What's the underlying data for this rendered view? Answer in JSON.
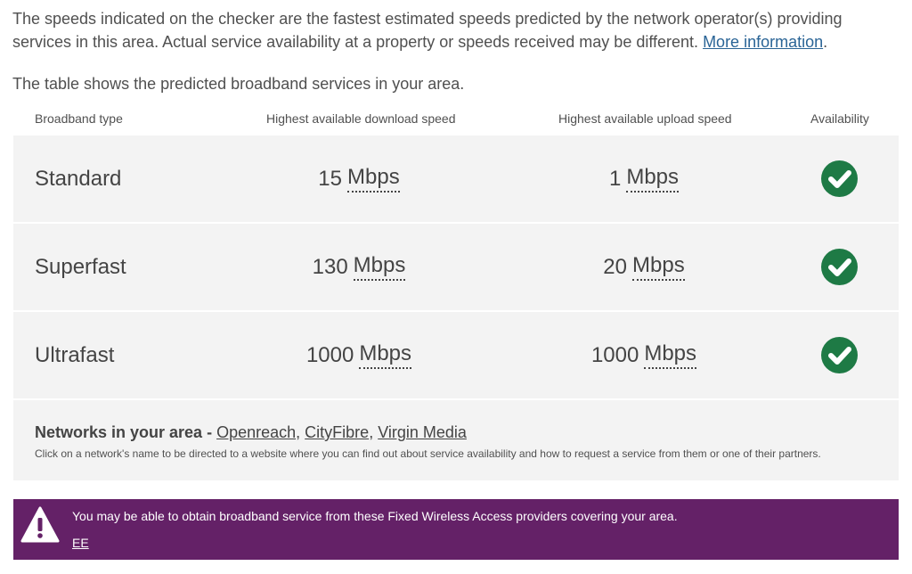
{
  "intro": {
    "text": "The speeds indicated on the checker are the fastest estimated speeds predicted by the network operator(s) providing services in this area. Actual service availability at a property or speeds received may be different.",
    "link_label": "More information",
    "suffix": "."
  },
  "table_caption": "The table shows the predicted broadband services in your area.",
  "table": {
    "headers": {
      "type": "Broadband type",
      "download": "Highest available download speed",
      "upload": "Highest available upload speed",
      "availability": "Availability"
    },
    "rows": [
      {
        "type": "Standard",
        "download": "15",
        "upload": "1",
        "unit": "Mbps",
        "available": true
      },
      {
        "type": "Superfast",
        "download": "130",
        "upload": "20",
        "unit": "Mbps",
        "available": true
      },
      {
        "type": "Ultrafast",
        "download": "1000",
        "upload": "1000",
        "unit": "Mbps",
        "available": true
      }
    ],
    "check_color": "#1e7a45"
  },
  "networks": {
    "heading": "Networks in your area -",
    "links": [
      "Openreach",
      "CityFibre",
      "Virgin Media"
    ],
    "note": "Click on a network's name to be directed to a website where you can find out about service availability and how to request a service from them or one of their partners."
  },
  "fwa": {
    "message": "You may be able to obtain broadband service from these Fixed Wireless Access providers covering your area.",
    "provider": "EE",
    "background": "#642167",
    "icon": "warning-icon"
  }
}
